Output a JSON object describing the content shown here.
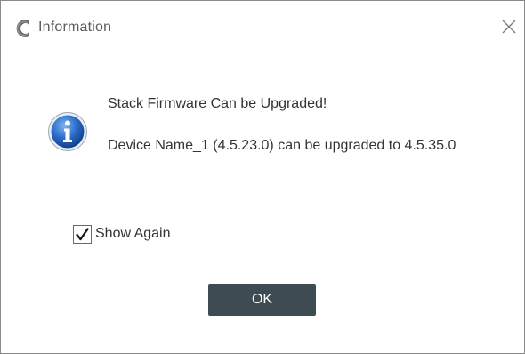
{
  "window": {
    "title": "Information",
    "logo_icon": "app-logo-icon",
    "close_icon": "close-icon"
  },
  "message": {
    "icon": "info-icon",
    "line1": "Stack Firmware Can be Upgraded!",
    "line2": "Device Name_1 (4.5.23.0) can be upgraded to 4.5.35.0"
  },
  "show_again": {
    "label": "Show Again",
    "checked": true
  },
  "buttons": {
    "ok_label": "OK"
  },
  "colors": {
    "button_bg": "#3e4b52",
    "info_blue": "#1f5fb8",
    "border": "#8a8a8a"
  }
}
